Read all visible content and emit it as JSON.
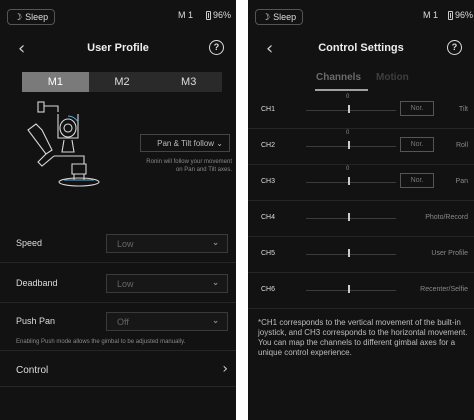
{
  "left": {
    "status": {
      "sleep": "Sleep",
      "mode": "M 1",
      "battery": "96%"
    },
    "title": "User Profile",
    "help": "?",
    "segments": [
      {
        "label": "M1",
        "active": true
      },
      {
        "label": "M2",
        "active": false
      },
      {
        "label": "M3",
        "active": false
      }
    ],
    "follow": {
      "value": "Pan & Tilt follow",
      "description": "Ronin will follow your movement on Pan and Tilt axes."
    },
    "settings": [
      {
        "label": "Speed",
        "value": "Low"
      },
      {
        "label": "Deadband",
        "value": "Low"
      },
      {
        "label": "Push Pan",
        "value": "Off"
      }
    ],
    "push_note": "Enabling Push mode allows the gimbal to be adjusted manually.",
    "control": "Control"
  },
  "right": {
    "status": {
      "sleep": "Sleep",
      "mode": "M 1",
      "battery": "96%"
    },
    "title": "Control Settings",
    "help": "?",
    "tabs": {
      "channels": "Channels",
      "motion": "Motion"
    },
    "channels": [
      {
        "name": "CH1",
        "zero": "0",
        "button": "Nor.",
        "function": "Tilt"
      },
      {
        "name": "CH2",
        "zero": "0",
        "button": "Nor.",
        "function": "Roll"
      },
      {
        "name": "CH3",
        "zero": "0",
        "button": "Nor.",
        "function": "Pan"
      },
      {
        "name": "CH4",
        "zero": "",
        "button": "",
        "function": "Photo/Record"
      },
      {
        "name": "CH5",
        "zero": "",
        "button": "",
        "function": "User Profile"
      },
      {
        "name": "CH6",
        "zero": "",
        "button": "",
        "function": "Recenter/Selfie"
      }
    ],
    "description": "*CH1 corresponds to the vertical movement of the built-in joystick, and CH3 corresponds to the horizontal movement. You can map the channels to different gimbal axes for a unique control experience."
  }
}
